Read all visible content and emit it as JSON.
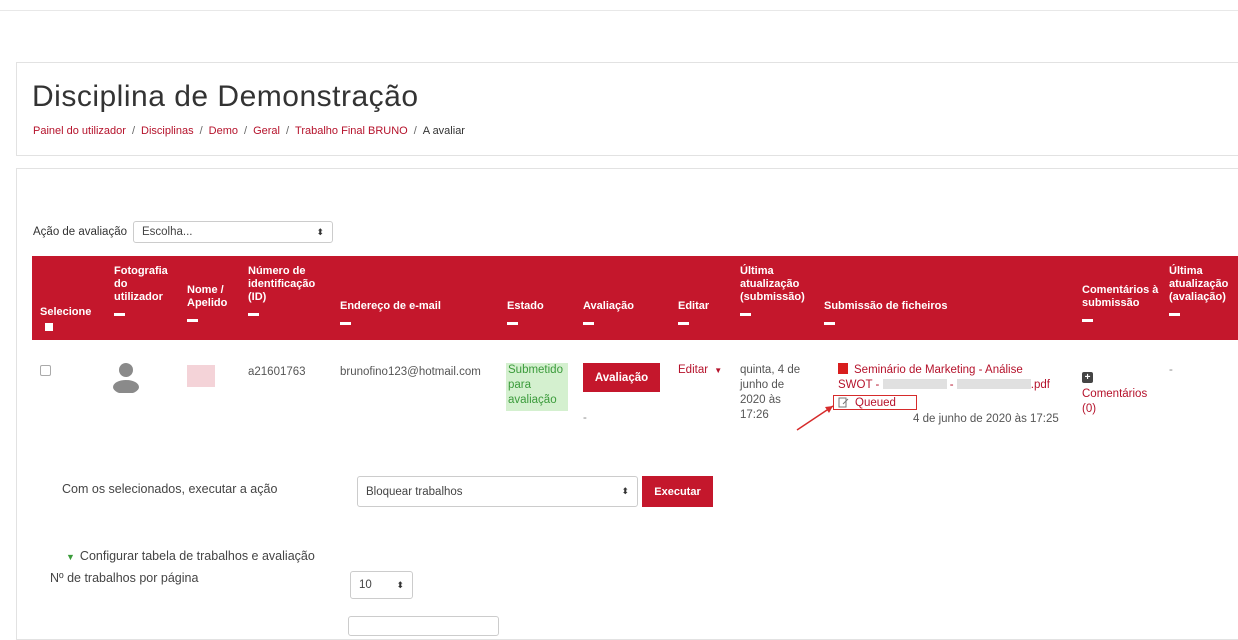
{
  "page": {
    "title": "Disciplina de Demonstração"
  },
  "breadcrumb": [
    "Painel do utilizador",
    "Disciplinas",
    "Demo",
    "Geral",
    "Trabalho Final BRUNO",
    "A avaliar"
  ],
  "grading_action": {
    "label": "Ação de avaliação",
    "selected": "Escolha..."
  },
  "table": {
    "headers": {
      "select": "Selecione",
      "photo": "Fotografia do utilizador",
      "name": "Nome / Apelido",
      "id": "Número de identificação (ID)",
      "email": "Endereço de e-mail",
      "status": "Estado",
      "grade": "Avaliação",
      "edit": "Editar",
      "last_modified": "Última atualização (submissão)",
      "files": "Submissão de ficheiros",
      "comments": "Comentários à submissão",
      "last_grade": "Última atualização (avaliação)"
    },
    "row": {
      "id": "a21601763",
      "email": "brunofino123@hotmail.com",
      "status": "Submetido para avaliação",
      "grade_button": "Avaliação",
      "grade_value": "-",
      "edit": "Editar",
      "last_modified": "quinta, 4 de junho de 2020 às 17:26",
      "file_name_start": "Seminário de Marketing - Análise",
      "file_name_mid": "SWOT -",
      "file_name_sep": "-",
      "file_ext": ".pdf",
      "queued": "Queued",
      "file_timestamp": "4 de junho de 2020 às 17:25",
      "comments_link": "Comentários (0)",
      "last_grade": "-"
    }
  },
  "bulk": {
    "label": "Com os selecionados, executar a ação",
    "selected": "Bloquear trabalhos",
    "button": "Executar"
  },
  "options": {
    "toggle": "Configurar tabela de trabalhos e avaliação",
    "per_page_label": "Nº de trabalhos por página",
    "per_page_value": "10"
  },
  "colors": {
    "accent": "#c4172c",
    "status_bg": "#d4f0cf",
    "status_text": "#3b9b3b"
  }
}
